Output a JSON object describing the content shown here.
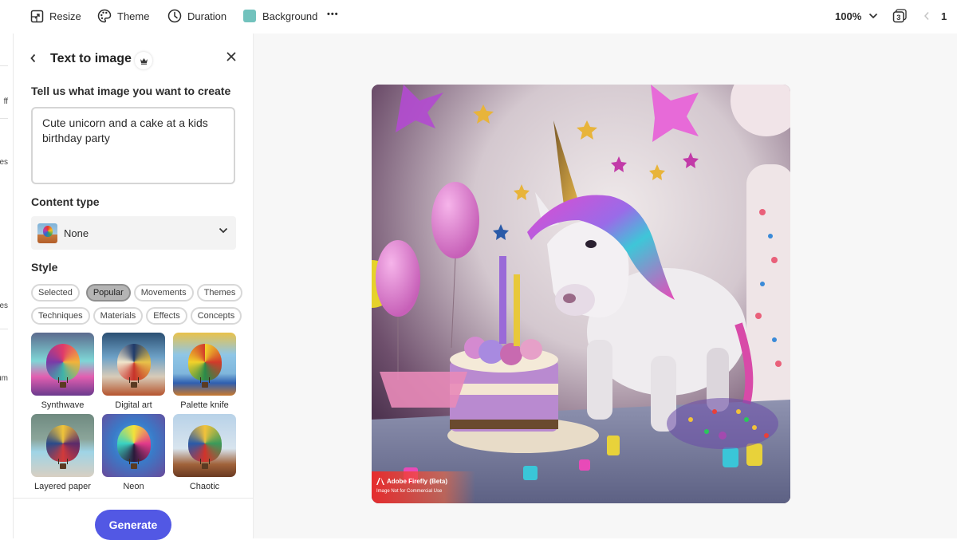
{
  "toolbar": {
    "resize_label": "Resize",
    "theme_label": "Theme",
    "duration_label": "Duration",
    "background_label": "Background",
    "background_color": "#72c2bd",
    "more_label": "•••",
    "zoom_value": "100%",
    "pages_count": "3",
    "page_number": "1"
  },
  "left_rail": {
    "fragments": [
      "ff",
      "es",
      "es",
      "um"
    ]
  },
  "panel": {
    "title": "Text to image",
    "prompt_label": "Tell us what image you want to create",
    "prompt_value": "Cute unicorn and a cake at a kids birthday party",
    "content_type_label": "Content type",
    "content_type_value": "None",
    "style_label": "Style",
    "style_chips_row1": [
      "Selected",
      "Popular",
      "Movements",
      "Themes"
    ],
    "style_chips_row2": [
      "Techniques",
      "Materials",
      "Effects",
      "Concepts"
    ],
    "active_chip": "Popular",
    "styles": [
      {
        "label": "Synthwave",
        "bg": "linear-gradient(180deg,#5b6b8e 0%,#7fd6d6 45%,#e25fb0 70%,#6b3a8e 100%)",
        "balloon": "conic-gradient(#e03a6a,#f2b33a,#3fb3a8,#7a3aa8,#e03a6a)"
      },
      {
        "label": "Digital art",
        "bg": "linear-gradient(180deg,#2b4f73 0%,#6fa3c8 40%,#d8cbb8 70%,#b5542d 100%)",
        "balloon": "conic-gradient(#1f3a6a,#e8c24a,#c7332a,#f0e6cc,#1f3a6a)"
      },
      {
        "label": "Palette knife",
        "bg": "linear-gradient(180deg,#e9c24a 0%,#8fc6e6 35%,#7fb6dc 65%,#2f5fb0 80%,#c9792e 100%)",
        "balloon": "conic-gradient(#f2d22a,#d23a2a,#2a8a4a,#f2d22a,#d23a2a)"
      },
      {
        "label": "Layered paper",
        "bg": "linear-gradient(180deg,#6f8a80 0%,#8ba59a 40%,#9fd4e6 60%,#d8cfc2 100%)",
        "balloon": "conic-gradient(#f0c43a,#5a2a6a,#d23a3a,#2a4a8a,#f0c43a)"
      },
      {
        "label": "Neon",
        "bg": "radial-gradient(circle at 50% 45%,#4ab0e6 0%,#3a7ac8 45%,#6a4a9a 100%)",
        "balloon": "conic-gradient(#f2e23a,#e23a8a,#2a1a3a,#3ad2c2,#f2e23a)"
      },
      {
        "label": "Chaotic",
        "bg": "linear-gradient(180deg,#b8d2e8 0%,#d8e4ee 55%,#a0623a 80%,#6a3a22 100%)",
        "balloon": "conic-gradient(#f2c23a,#3a9a5a,#d2332a,#2a5aa8,#f2c23a)"
      }
    ],
    "generate_label": "Generate",
    "accent_color": "#5258e4"
  },
  "canvas": {
    "image_alt": "Cute unicorn and a cake at a kids birthday party",
    "watermark_title": "Adobe Firefly (Beta)",
    "watermark_subtitle": "Image Not for Commercial Use"
  }
}
